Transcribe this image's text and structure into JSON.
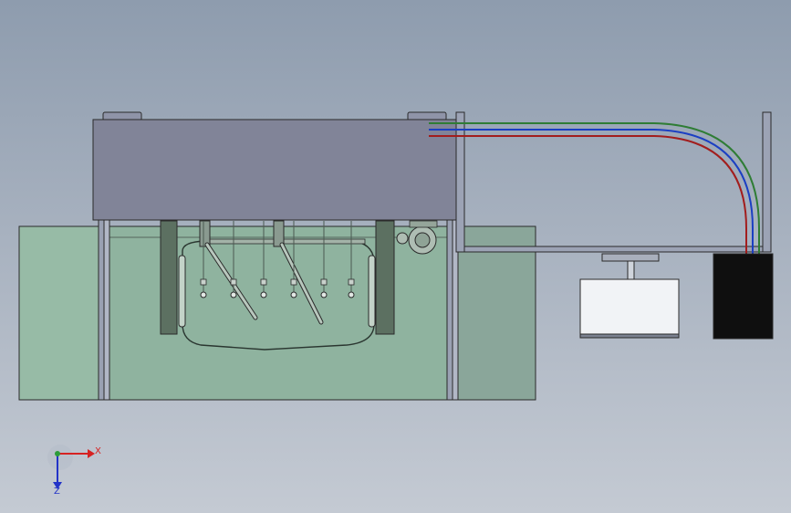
{
  "triad": {
    "x_label": "X",
    "z_label": "Z"
  },
  "colors": {
    "background_top": "#8e9cae",
    "background_bottom": "#c4cad3",
    "tank": "#8fb39f",
    "top_housing": "#818498",
    "pipe_green": "#2f7d35",
    "pipe_blue": "#1b3fc3",
    "pipe_red": "#a21d1d",
    "container": "#0f0f0f",
    "bin": "#f1f3f6"
  }
}
